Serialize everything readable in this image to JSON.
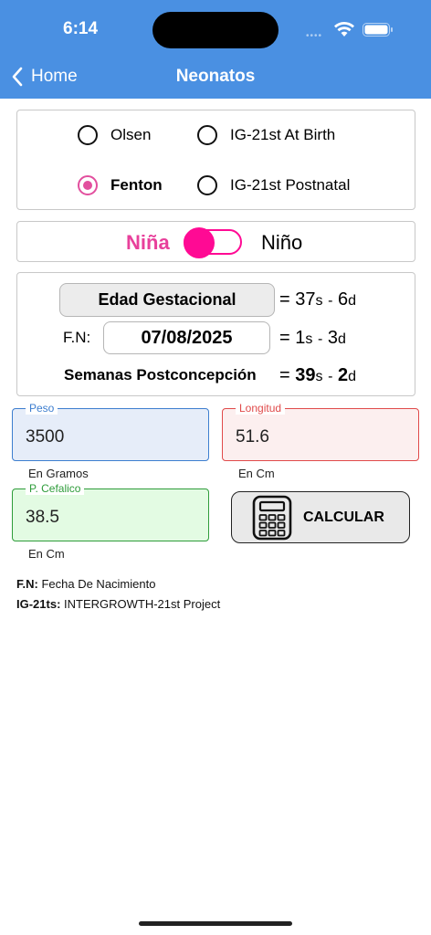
{
  "status": {
    "time": "6:14",
    "signal_icon": "cellular-dots-icon",
    "wifi_icon": "wifi-icon",
    "battery_icon": "battery-icon"
  },
  "nav": {
    "back_label": "Home",
    "title": "Neonatos",
    "back_icon": "chevron-left-icon"
  },
  "charts": {
    "options": [
      {
        "label": "Olsen",
        "selected": false
      },
      {
        "label": "IG-21st At Birth",
        "selected": false
      },
      {
        "label": "Fenton",
        "selected": true
      },
      {
        "label": "IG-21st Postnatal",
        "selected": false
      }
    ]
  },
  "gender": {
    "female_label": "Niña",
    "male_label": "Niño",
    "selected": "Niña",
    "accent": "#ff0a94"
  },
  "gestation": {
    "button_label": "Edad Gestacional",
    "eq1": "=",
    "weeks": "37",
    "weeks_unit": "s",
    "sep": "-",
    "days": "6",
    "days_unit": "d",
    "fn_label": "F.N:",
    "birth_date": "07/08/2025",
    "eq2": "=",
    "age_weeks": "1",
    "age_weeks_unit": "s",
    "age_sep": "-",
    "age_days": "3",
    "age_days_unit": "d",
    "pc_label": "Semanas Postconcepción",
    "eq3": "=",
    "pc_weeks": "39",
    "pc_weeks_unit": "s",
    "pc_sep": "-",
    "pc_days": "2",
    "pc_days_unit": "d"
  },
  "fields": {
    "peso": {
      "legend": "Peso",
      "value": "3500",
      "unit": "En Gramos",
      "color": "#3d7ecf"
    },
    "longitud": {
      "legend": "Longitud",
      "value": "51.6",
      "unit": "En Cm",
      "color": "#e04a4a"
    },
    "cefalico": {
      "legend": "P. Cefalico",
      "value": "38.5",
      "unit": "En Cm",
      "color": "#2e9c3a"
    }
  },
  "calc": {
    "label": "CALCULAR",
    "icon": "calculator-icon"
  },
  "footnotes": [
    {
      "key": "F.N:",
      "text": " Fecha De Nacimiento"
    },
    {
      "key": "IG-21ts:",
      "text": " INTERGROWTH-21st Project"
    }
  ]
}
